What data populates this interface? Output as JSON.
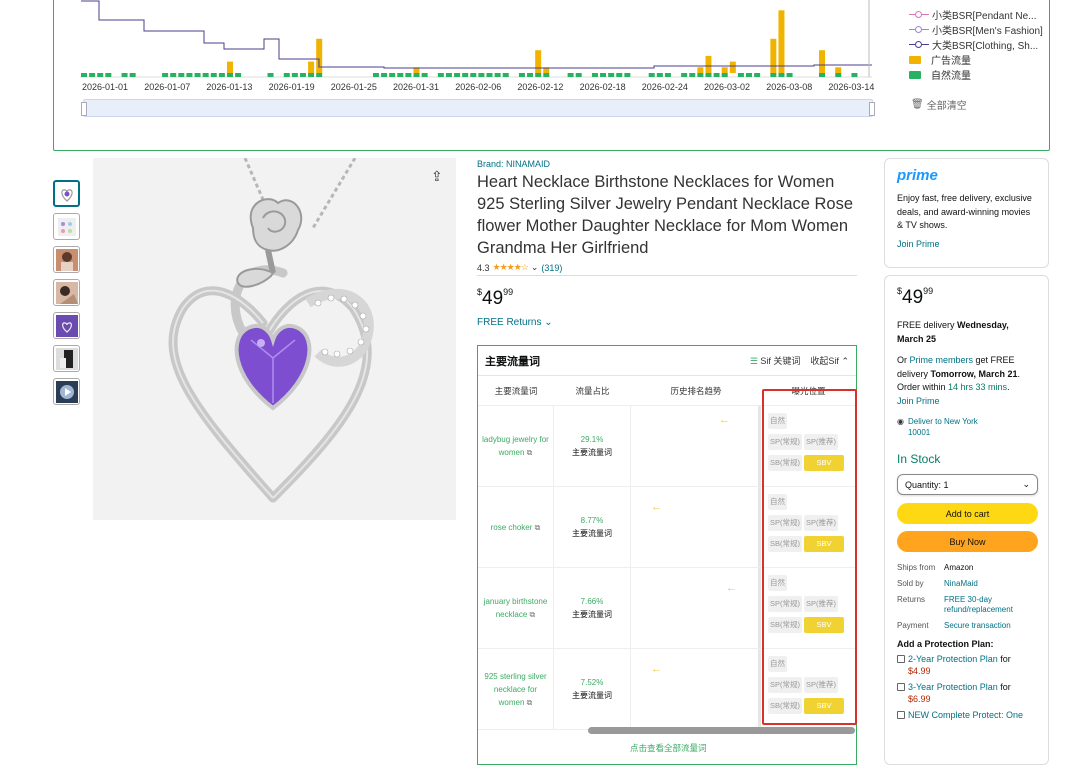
{
  "chart": {
    "x_ticks": [
      "2026-01-01",
      "2026-01-07",
      "2026-01-13",
      "2026-01-19",
      "2026-01-25",
      "2026-01-31",
      "2026-02-06",
      "2026-02-12",
      "2026-02-18",
      "2026-02-24",
      "2026-03-02",
      "2026-03-08",
      "2026-03-14"
    ],
    "legend": [
      {
        "label": "小类BSR[Pendant Ne...",
        "color": "#d876b5",
        "kind": "line"
      },
      {
        "label": "小类BSR[Men's Fashion]",
        "color": "#9b87d6",
        "kind": "line"
      },
      {
        "label": "大类BSR[Clothing, Sh...",
        "color": "#4b3e8f",
        "kind": "line"
      },
      {
        "label": "广告流量",
        "color": "#f0b400",
        "kind": "box"
      },
      {
        "label": "自然流量",
        "color": "#27b163",
        "kind": "box"
      }
    ],
    "clear_label": "全部清空"
  },
  "chart_data": {
    "type": "bar",
    "x_ticks": [
      "2026-01-01",
      "2026-01-07",
      "2026-01-13",
      "2026-01-19",
      "2026-01-25",
      "2026-01-31",
      "2026-02-06",
      "2026-02-12",
      "2026-02-18",
      "2026-02-24",
      "2026-03-02",
      "2026-03-08",
      "2026-03-14"
    ],
    "series": [
      {
        "name": "广告流量",
        "color": "#f0b400",
        "values": [
          0,
          0,
          0,
          0,
          0,
          0,
          0,
          0,
          0,
          0,
          0,
          0,
          0,
          0,
          0,
          0,
          0,
          0,
          2,
          0,
          0,
          0,
          0,
          0,
          0,
          0,
          0,
          0,
          2,
          6,
          0,
          0,
          0,
          0,
          0,
          0,
          0,
          0,
          0,
          0,
          0,
          1,
          0,
          0,
          0,
          0,
          0,
          0,
          0,
          0,
          0,
          0,
          0,
          0,
          0,
          0,
          4,
          1,
          0,
          0,
          0,
          0,
          0,
          0,
          0,
          0,
          0,
          0,
          0,
          0,
          0,
          0,
          0,
          0,
          0,
          0,
          1,
          3,
          0,
          1,
          2,
          0,
          0,
          0,
          0,
          6,
          11,
          0,
          0,
          0,
          0,
          4,
          0,
          1,
          0,
          0
        ]
      },
      {
        "name": "自然流量",
        "color": "#27b163",
        "values": [
          1,
          1,
          1,
          1,
          0,
          1,
          1,
          0,
          0,
          0,
          1,
          1,
          1,
          1,
          1,
          1,
          1,
          1,
          1,
          1,
          0,
          0,
          0,
          1,
          0,
          1,
          1,
          1,
          1,
          1,
          0,
          0,
          0,
          0,
          0,
          0,
          1,
          1,
          1,
          1,
          1,
          1,
          1,
          0,
          1,
          1,
          1,
          1,
          1,
          1,
          1,
          1,
          1,
          0,
          1,
          1,
          1,
          1,
          0,
          0,
          1,
          1,
          0,
          1,
          1,
          1,
          1,
          1,
          0,
          0,
          1,
          1,
          1,
          0,
          1,
          1,
          1,
          1,
          1,
          1,
          0,
          1,
          1,
          1,
          0,
          1,
          1,
          1,
          0,
          0,
          0,
          1,
          0,
          1,
          0,
          1
        ]
      },
      {
        "name": "小类BSR[Pendant Ne...",
        "color": "#d876b5",
        "values": []
      },
      {
        "name": "小类BSR[Men's Fashion]",
        "color": "#9b87d6",
        "values": []
      },
      {
        "name": "大类BSR[Clothing, Sh...",
        "color": "#4b3e8f",
        "values": []
      }
    ]
  },
  "product": {
    "brand": "Brand: NINAMAID",
    "title": "Heart Necklace Birthstone Necklaces for Women 925 Sterling Silver Jewelry Pendant Necklace Rose flower Mother Daughter Necklace for Mom Women Grandma Her Girlfriend",
    "rating": "4.3",
    "stars": "★★★★☆",
    "review_count": "(319)",
    "price_symbol": "$",
    "price_whole": "49",
    "price_frac": "99",
    "free_returns": "FREE Returns"
  },
  "keywords": {
    "title": "主要流量词",
    "tool_keyword": "Sif 关键词",
    "tool_collapse": "收起Sif",
    "cols": [
      "主要流量词",
      "流量占比",
      "历史排名趋势",
      "曝光位置"
    ],
    "rows": [
      {
        "kw": "ladybug jewelry for women",
        "pct": "29.1%",
        "type": "主要流量词"
      },
      {
        "kw": "rose choker",
        "pct": "8.77%",
        "type": "主要流量词"
      },
      {
        "kw": "january birthstone necklace",
        "pct": "7.66%",
        "type": "主要流量词"
      },
      {
        "kw": "925 sterling silver necklace for women",
        "pct": "7.52%",
        "type": "主要流量词"
      }
    ],
    "tags": {
      "natural": "自然",
      "sp_regular": "SP(常规)",
      "sp_recommend": "SP(推荐)",
      "sb_regular": "SB(常规)",
      "sbv": "SBV"
    },
    "more": "点击查看全部流量词"
  },
  "prime": {
    "logo": "prime",
    "text": "Enjoy fast, free delivery, exclusive deals, and award-winning movies & TV shows.",
    "join": "Join Prime"
  },
  "buybox": {
    "price_symbol": "$",
    "price_whole": "49",
    "price_frac": "99",
    "delivery_pre": "FREE delivery ",
    "delivery_date": "Wednesday, March 25",
    "or": "Or ",
    "prime_members": "Prime members",
    "fast_pre": " get FREE delivery ",
    "fast_date": "Tomorrow, March 21",
    "order_within_pre": ". Order within ",
    "order_within": "14 hrs 33 mins",
    "join_prime": "Join Prime",
    "deliver_to": "Deliver to New York 10001",
    "in_stock": "In Stock",
    "quantity": "Quantity: 1",
    "add_to_cart": "Add to cart",
    "buy_now": "Buy Now",
    "info": [
      {
        "k": "Ships from",
        "v": "Amazon",
        "link": false
      },
      {
        "k": "Sold by",
        "v": "NinaMaid",
        "link": true
      },
      {
        "k": "Returns",
        "v": "FREE 30-day refund/replacement",
        "link": true
      },
      {
        "k": "Payment",
        "v": "Secure transaction",
        "link": true
      }
    ],
    "protection_title": "Add a Protection Plan:",
    "plans": [
      {
        "label": "2-Year Protection Plan",
        "for": " for ",
        "price": "$4.99"
      },
      {
        "label": "3-Year Protection Plan",
        "for": " for ",
        "price": "$6.99"
      },
      {
        "label": "NEW Complete Protect: One",
        "for": "",
        "price": ""
      }
    ]
  }
}
